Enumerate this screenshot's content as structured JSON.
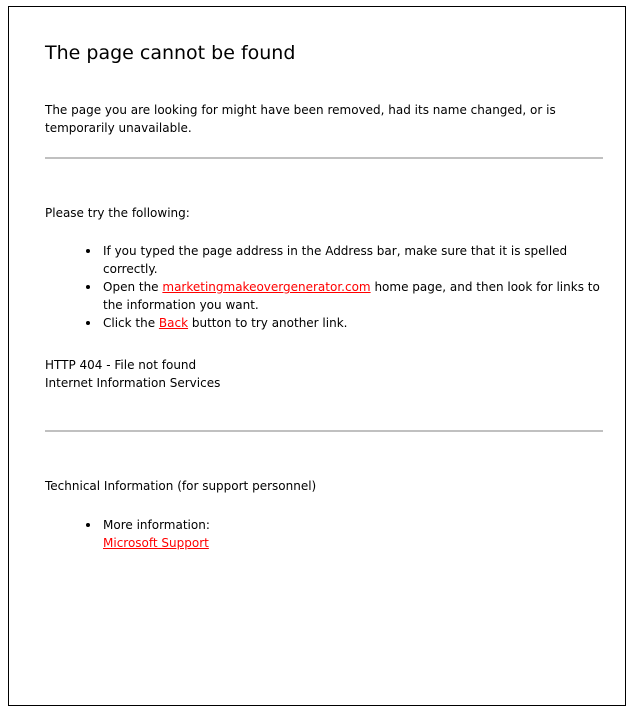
{
  "page": {
    "title": "The page cannot be found",
    "intro": "The page you are looking for might have been removed, had its name changed, or is temporarily unavailable.",
    "try_heading": "Please try the following:",
    "suggestions": {
      "item1": "If you typed the page address in the Address bar, make sure that it is spelled correctly.",
      "item2_pre": "Open the ",
      "item2_link": "marketingmakeovergenerator.com",
      "item2_post": " home page, and then look for links to the information you want.",
      "item3_pre": "Click the ",
      "item3_link": "Back",
      "item3_post": " button to try another link."
    },
    "error_code": "HTTP 404 - File not found",
    "server": "Internet Information Services",
    "tech_heading": "Technical Information (for support personnel)",
    "tech": {
      "more_info": "More information:",
      "support_link": "Microsoft Support"
    }
  },
  "colors": {
    "link": "#ff0000",
    "rule": "#c0c0c0"
  }
}
